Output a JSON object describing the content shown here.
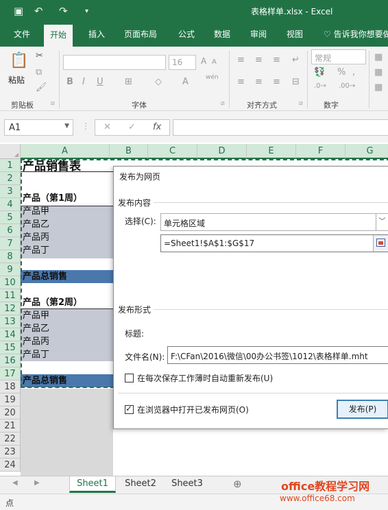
{
  "window": {
    "title": "表格样单.xlsx - Excel"
  },
  "quick_access": {
    "save_icon": "save-icon",
    "undo_icon": "undo-icon",
    "redo_icon": "redo-icon",
    "customize_icon": "customize-qat-icon"
  },
  "ribbon_tabs": [
    {
      "label": "文件"
    },
    {
      "label": "开始"
    },
    {
      "label": "插入"
    },
    {
      "label": "页面布局"
    },
    {
      "label": "公式"
    },
    {
      "label": "数据"
    },
    {
      "label": "审阅"
    },
    {
      "label": "视图"
    },
    {
      "label": "告诉我你想要做"
    }
  ],
  "ribbon": {
    "paste_label": "粘贴",
    "font_size": "16",
    "wen_label": "wén",
    "number_format": "常规",
    "groups": {
      "clipboard": "剪贴板",
      "font": "字体",
      "alignment": "对齐方式",
      "number": "数字"
    }
  },
  "formula_bar": {
    "name_box": "A1",
    "fx": "fx"
  },
  "columns": [
    "A",
    "B",
    "C",
    "D",
    "E",
    "F",
    "G"
  ],
  "rows": [
    "1",
    "2",
    "3",
    "4",
    "5",
    "6",
    "7",
    "8",
    "9",
    "10",
    "11",
    "12",
    "13",
    "14",
    "15",
    "16",
    "17",
    "18",
    "19",
    "20",
    "21",
    "22",
    "23",
    "24"
  ],
  "cells": {
    "r1": "产品销售表",
    "r3": "产品（第1周）",
    "r4": "产品甲",
    "r5": "产品乙",
    "r6": "产品丙",
    "r7": "产品丁",
    "r9": "产品总销售",
    "r11": "产品（第2周）",
    "r12": "产品甲",
    "r13": "产品乙",
    "r14": "产品丙",
    "r15": "产品丁",
    "r17": "产品总销售"
  },
  "dialog": {
    "title": "发布为网页",
    "section_content": "发布内容",
    "select_label": "选择(C):",
    "select_value": "单元格区域",
    "range_value": "=Sheet1!$A$1:$G$17",
    "section_form": "发布形式",
    "heading_label": "标题:",
    "filename_label": "文件名(N):",
    "filename_value": "F:\\CFan\\2016\\微信\\00办公书签\\1012\\表格样单.mht",
    "autorepublish_label": "在每次保存工作薄时自动重新发布(U)",
    "autorepublish_checked": false,
    "open_browser_label": "在浏览器中打开已发布网页(O)",
    "open_browser_checked": true,
    "publish_button": "发布(P)"
  },
  "sheet_tabs": [
    {
      "label": "Sheet1"
    },
    {
      "label": "Sheet2"
    },
    {
      "label": "Sheet3"
    }
  ],
  "status": {
    "mode": "点"
  },
  "watermark": {
    "line1": "office教程学习网",
    "line2": "www.office68.com"
  }
}
